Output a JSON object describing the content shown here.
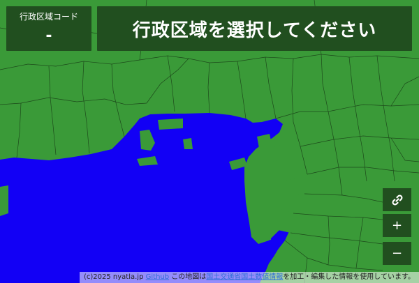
{
  "colors": {
    "land": "#3a9a38",
    "sea": "#1200f5",
    "boundary": "#1d4a1b",
    "panel": "#214f1f",
    "panel_text": "#ffffff"
  },
  "header": {
    "code_label": "行政区域コード",
    "code_value": "-",
    "title": "行政区域を選択してください"
  },
  "controls": {
    "link_icon": "link-icon",
    "zoom_in_label": "+",
    "zoom_out_label": "−"
  },
  "footer": {
    "copyright": "(c)2025 nyatla.jp",
    "github_link": "Github",
    "notice_prefix": " この地図は",
    "source_link": "国土交通省国土数値情報",
    "notice_suffix": "を加工・編集した情報を使用しています。"
  }
}
